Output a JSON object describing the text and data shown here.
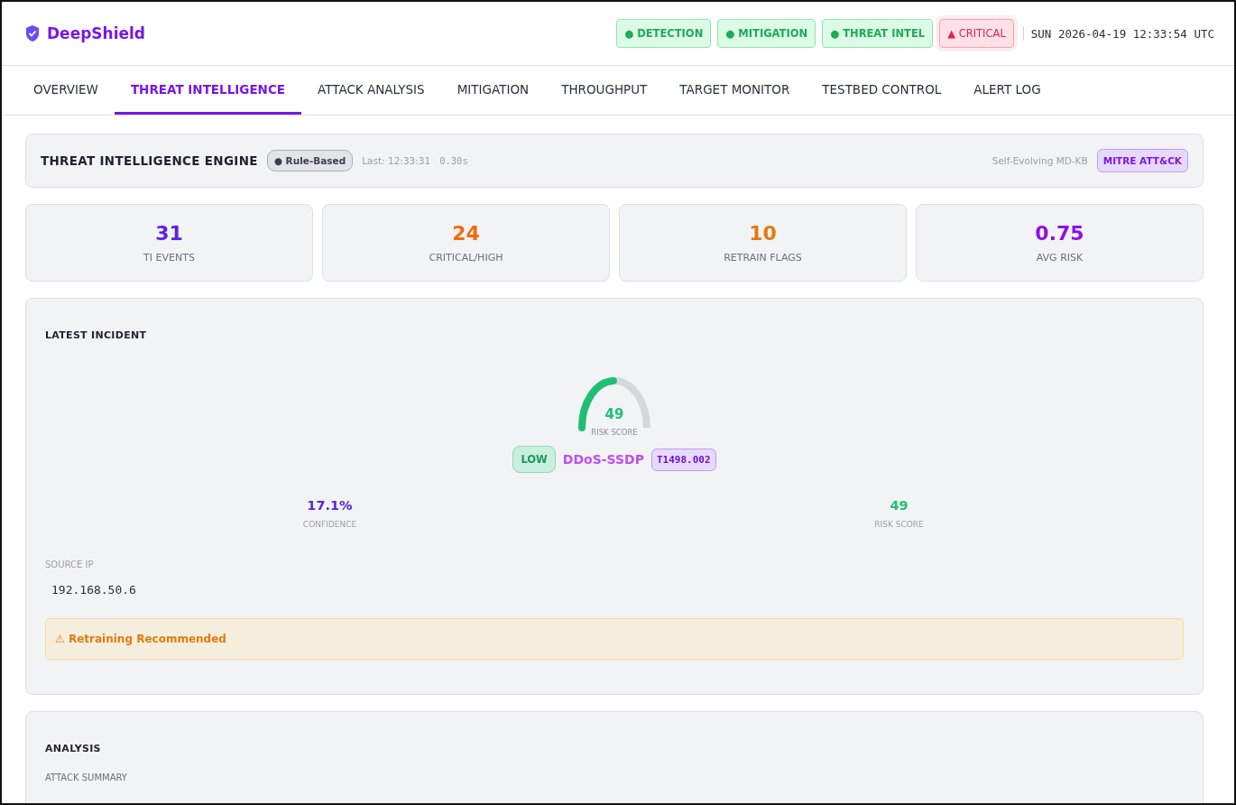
{
  "brand": {
    "name": "DeepShield"
  },
  "status_pills": [
    {
      "label": "● DETECTION",
      "kind": "ok"
    },
    {
      "label": "● MITIGATION",
      "kind": "ok"
    },
    {
      "label": "● THREAT INTEL",
      "kind": "ok"
    },
    {
      "label": "▲ CRITICAL",
      "kind": "alert"
    }
  ],
  "clock": "SUN 2026-04-19 12:33:54 UTC",
  "tabs": [
    {
      "label": "OVERVIEW",
      "selected": false
    },
    {
      "label": "THREAT INTELLIGENCE",
      "selected": true
    },
    {
      "label": "ATTACK ANALYSIS",
      "selected": false
    },
    {
      "label": "MITIGATION",
      "selected": false
    },
    {
      "label": "THROUGHPUT",
      "selected": false
    },
    {
      "label": "TARGET MONITOR",
      "selected": false
    },
    {
      "label": "TESTBED CONTROL",
      "selected": false
    },
    {
      "label": "ALERT LOG",
      "selected": false
    }
  ],
  "engine": {
    "title": "THREAT INTELLIGENCE ENGINE",
    "mode_badge": "● Rule-Based",
    "last": "Last: 12:33:31",
    "duration": "0.30s",
    "kb_label": "Self-Evolving MD-KB",
    "framework_badge": "MITRE ATT&CK"
  },
  "stats": [
    {
      "value": "31",
      "label": "TI EVENTS",
      "color": "#5b21e6"
    },
    {
      "value": "24",
      "label": "CRITICAL/HIGH",
      "color": "#f26b0f"
    },
    {
      "value": "10",
      "label": "RETRAIN FLAGS",
      "color": "#e07b10"
    },
    {
      "value": "0.75",
      "label": "AVG RISK",
      "color": "#8b10e8"
    }
  ],
  "incident": {
    "title": "LATEST INCIDENT",
    "gauge": {
      "value": "49",
      "label": "RISK SCORE"
    },
    "severity": "LOW",
    "attack": "DDoS-SSDP",
    "technique": "T1498.002",
    "metrics": [
      {
        "value": "17.1%",
        "label": "CONFIDENCE",
        "color": "#5b21e6"
      },
      {
        "value": "49",
        "label": "RISK SCORE",
        "color": "#1fbf73"
      }
    ],
    "source_ip_label": "SOURCE IP",
    "source_ip": "192.168.50.6",
    "warning": "⚠ Retraining Recommended"
  },
  "analysis": {
    "title": "ANALYSIS",
    "subtitle": "ATTACK SUMMARY"
  }
}
